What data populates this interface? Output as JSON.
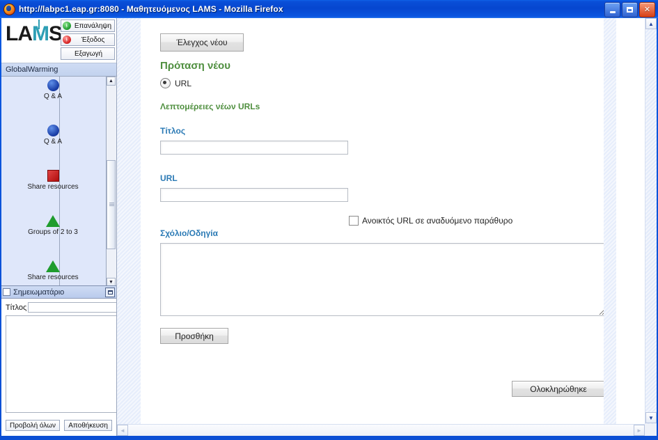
{
  "window": {
    "title": "http://labpc1.eap.gr:8080 - Μαθητευόμενος LAMS - Mozilla Firefox",
    "icons": {
      "app": "firefox-icon",
      "minimize": "minimize-icon",
      "maximize": "maximize-icon",
      "close": "close-icon"
    }
  },
  "sidebar": {
    "logo": {
      "lead": "LA",
      "accent": "M",
      "tail": "S"
    },
    "buttons": [
      {
        "label": "Επανάληψη",
        "icon": "refresh-icon",
        "icon_color": "#1f9c2e"
      },
      {
        "label": "Έξοδος",
        "icon": "exit-icon",
        "icon_color": "#d41f1f"
      },
      {
        "label": "Εξαγωγή",
        "icon": "none",
        "icon_color": ""
      }
    ],
    "sequence_title": "GlobalWarming",
    "activities": [
      {
        "label": "Q & A",
        "shape": "circle",
        "color": "#1b3fa8"
      },
      {
        "label": "Q & A",
        "shape": "circle",
        "color": "#1b3fa8"
      },
      {
        "label": "Share resources",
        "shape": "square",
        "color": "#b00d0d"
      },
      {
        "label": "Groups of 2 to 3",
        "shape": "triangle",
        "color": "#1f9c2e"
      },
      {
        "label": "Share resources",
        "shape": "triangle",
        "color": "#1f9c2e"
      }
    ],
    "notebook": {
      "title": "Σημειωματάριο",
      "title_label": "Τίτλος",
      "title_value": "",
      "body_value": "",
      "view_all_label": "Προβολή όλων",
      "save_label": "Αποθήκευση"
    }
  },
  "main": {
    "check_button": "Έλεγχος νέου",
    "proposal_heading": "Πρόταση νέου",
    "resource_type_radio": "URL",
    "details_heading": "Λεπτομέρειες νέων URLs",
    "title_label": "Τίτλος",
    "title_value": "",
    "url_label": "URL",
    "url_value": "",
    "popup_checkbox_label": "Ανοικτός URL σε αναδυόμενο παράθυρο",
    "comment_label": "Σχόλιο/Οδηγία",
    "comment_value": "",
    "add_button": "Προσθήκη",
    "done_button": "Ολοκληρώθηκε"
  },
  "colors": {
    "title_bar": "#0a4fd8",
    "heading_green": "#4f8f3f",
    "heading_blue": "#2b7ab5",
    "sidebar_bg": "#dfe7fa"
  },
  "scroll": {
    "up_glyph": "▲",
    "down_glyph": "▼",
    "left_glyph": "◄",
    "right_glyph": "►"
  }
}
